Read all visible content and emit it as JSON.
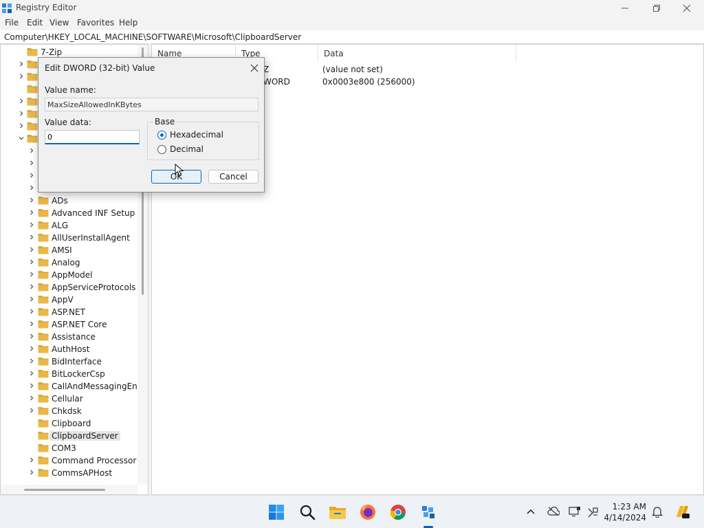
{
  "window": {
    "title": "Registry Editor",
    "minimize_glyph": "—",
    "close_glyph": "✕"
  },
  "menu": [
    "File",
    "Edit",
    "View",
    "Favorites",
    "Help"
  ],
  "address": "Computer\\HKEY_LOCAL_MACHINE\\SOFTWARE\\Microsoft\\ClipboardServer",
  "tree": {
    "top_items": [
      {
        "label": "7-Zip",
        "expander": "none"
      },
      {
        "label": "",
        "expander": "collapsed"
      },
      {
        "label": "",
        "expander": "collapsed"
      },
      {
        "label": "",
        "expander": "none"
      },
      {
        "label": "",
        "expander": "collapsed"
      },
      {
        "label": "",
        "expander": "collapsed"
      },
      {
        "label": "",
        "expander": "collapsed"
      },
      {
        "label": "",
        "expander": "expanded"
      }
    ],
    "child_hidden_rows": 4,
    "children": [
      "ADs",
      "Advanced INF Setup",
      "ALG",
      "AllUserInstallAgent",
      "AMSI",
      "Analog",
      "AppModel",
      "AppServiceProtocols",
      "AppV",
      "ASP.NET",
      "ASP.NET Core",
      "Assistance",
      "AuthHost",
      "BidInterface",
      "BitLockerCsp",
      "CallAndMessagingEnha",
      "Cellular",
      "Chkdsk",
      "Clipboard",
      "ClipboardServer",
      "COM3",
      "Command Processor",
      "CommsAPHost"
    ],
    "selected": "ClipboardServer",
    "children_without_expander": [
      "Clipboard",
      "ClipboardServer",
      "COM3"
    ]
  },
  "list": {
    "columns": [
      "Name",
      "Type",
      "Data"
    ],
    "rows": [
      {
        "type_partial": "Z",
        "data": "(value not set)"
      },
      {
        "type_partial": "WORD",
        "data": "0x0003e800 (256000)"
      }
    ]
  },
  "dialog": {
    "title": "Edit DWORD (32-bit) Value",
    "value_name_label": "Value name:",
    "value_name": "MaxSizeAllowedInKBytes",
    "value_data_label": "Value data:",
    "value_data": "0",
    "base_label": "Base",
    "options": [
      {
        "label": "Hexadecimal",
        "checked": true
      },
      {
        "label": "Decimal",
        "checked": false
      }
    ],
    "ok_label": "OK",
    "cancel_label": "Cancel",
    "close_glyph": "✕"
  },
  "taskbar": {
    "apps": [
      "start-icon",
      "search-icon",
      "file-explorer-icon",
      "firefox-icon",
      "chrome-icon",
      "registry-editor-icon"
    ],
    "active_app": "registry-editor-icon",
    "tray": [
      "chevron-up-icon",
      "onedrive-icon",
      "display-icon",
      "network-icon",
      "notification-bell-icon",
      "copilot-icon"
    ],
    "time": "1:23 AM",
    "date": "4/14/2024"
  },
  "colors": {
    "accent": "#0067c0",
    "folder": "#e8b84a",
    "selection": "#e5e5e5"
  }
}
